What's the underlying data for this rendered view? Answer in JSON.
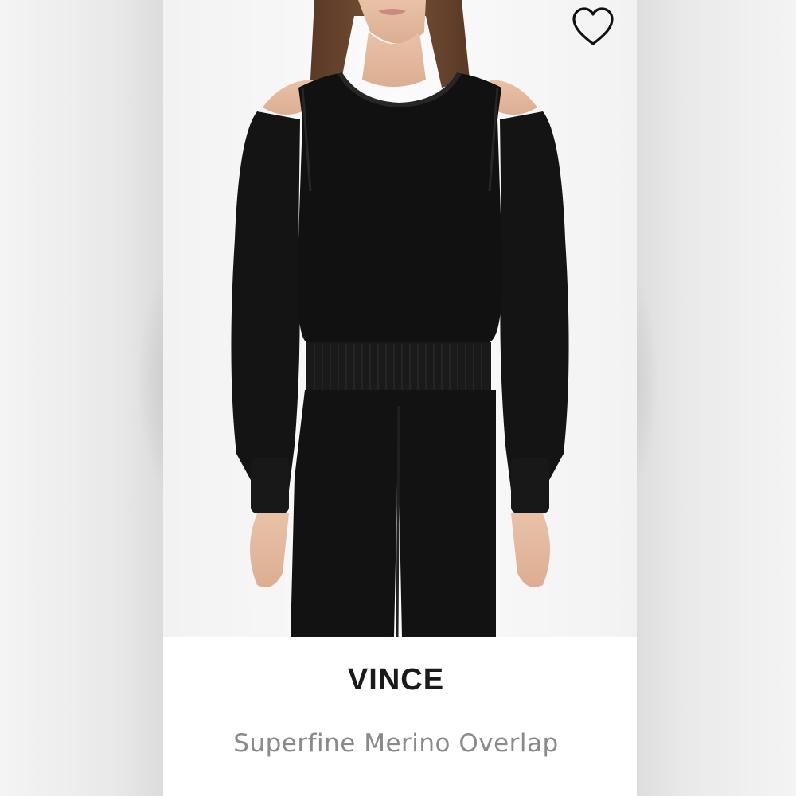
{
  "product": {
    "brand": "VINCE",
    "name": "Superfine Merino Overlap",
    "image_alt": "Model wearing black cold-shoulder merino sweater with black trousers"
  },
  "actions": {
    "favorite_icon": "heart-outline-icon"
  },
  "colors": {
    "brand_text": "#1a1a1a",
    "title_text": "#8a8a8a",
    "garment": "#141414",
    "icon": "#111111"
  }
}
